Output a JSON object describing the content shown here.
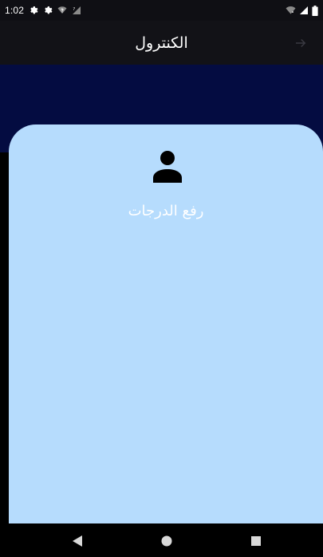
{
  "status_bar": {
    "time": "1:02",
    "icons_left": [
      "settings-gear-icon",
      "settings-gear-icon",
      "wifi-question-icon",
      "no-signal-icon"
    ],
    "icons_right": [
      "wifi-icon",
      "cellular-signal-icon",
      "battery-icon"
    ]
  },
  "app_bar": {
    "title": "الكنترول",
    "back_icon": "arrow-right-icon"
  },
  "card": {
    "icon": "person-icon",
    "label": "رفع الدرجات"
  },
  "nav_bar": {
    "buttons": [
      "back-triangle-icon",
      "home-circle-icon",
      "recents-square-icon"
    ]
  },
  "colors": {
    "status_bar": "#0f0f14",
    "app_bar": "#121217",
    "header_band": "#040c41",
    "card": "#b6dcfd",
    "text_light": "#ffffff"
  }
}
